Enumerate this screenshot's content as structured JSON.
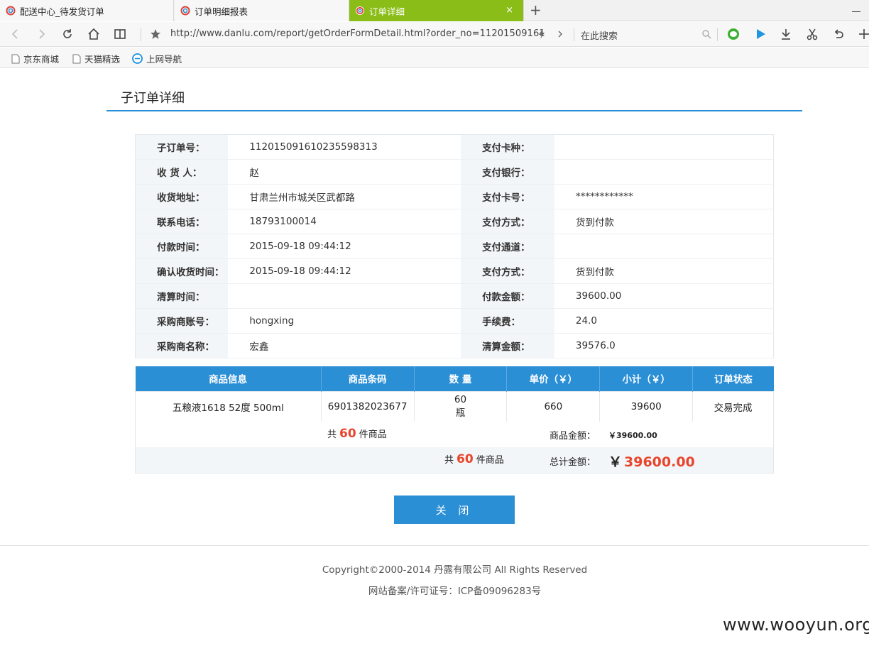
{
  "browser": {
    "tabs": [
      {
        "label": "配送中心_待发货订单"
      },
      {
        "label": "订单明细报表"
      },
      {
        "label": "订单详细"
      }
    ],
    "new_tab": "+",
    "tab_close": "×",
    "url": "http://www.danlu.com/report/getOrderFormDetail.html?order_no=11201509161",
    "search_placeholder": "在此搜索",
    "bookmarks": [
      {
        "label": "京东商城"
      },
      {
        "label": "天猫精选"
      },
      {
        "label": "上网导航"
      }
    ]
  },
  "page": {
    "title": "子订单详细",
    "info_rows": [
      {
        "l1": "子订单号：",
        "v1": "11201509161023559831​3",
        "l2": "支付卡种：",
        "v2": ""
      },
      {
        "l1": "收 货 人：",
        "v1": "赵",
        "l2": "支付银行：",
        "v2": ""
      },
      {
        "l1": "收货地址：",
        "v1": "甘肃兰州市城关区武都路",
        "l2": "支付卡号：",
        "v2": "************"
      },
      {
        "l1": "联系电话：",
        "v1": "18793100014",
        "l2": "支付方式：",
        "v2": "货到付款"
      },
      {
        "l1": "付款时间：",
        "v1": "2015-09-18 09:44:12",
        "l2": "支付通道：",
        "v2": ""
      },
      {
        "l1": "确认收货时间：",
        "v1": "2015-09-18 09:44:12",
        "l2": "支付方式：",
        "v2": "货到付款"
      },
      {
        "l1": "清算时间：",
        "v1": "",
        "l2": "付款金额：",
        "v2": "39600.00"
      },
      {
        "l1": "采购商账号：",
        "v1": "hongxing",
        "l2": "手续费：",
        "v2": "24.0"
      },
      {
        "l1": "采购商名称：",
        "v1": "宏鑫",
        "l2": "清算金额：",
        "v2": "39576.0"
      }
    ],
    "goods_headers": [
      "商品信息",
      "商品条码",
      "数 量",
      "单价（￥）",
      "小计（￥）",
      "订单状态"
    ],
    "goods_rows": [
      {
        "name": "五粮液1618 52度 500ml",
        "barcode": "6901382023677",
        "qty": "60",
        "unit": "瓶",
        "price": "660",
        "subtotal": "39600",
        "status": "交易完成"
      }
    ],
    "summary1": {
      "prefix": "共",
      "count": "60",
      "suffix": "件商品",
      "amount_label": "商品金额：",
      "amount": "￥39600.00"
    },
    "summary2": {
      "prefix": "共",
      "count": "60",
      "suffix": "件商品",
      "amount_label": "总计金额：",
      "yen": "￥",
      "amount": "39600.00"
    },
    "close_label": "关 闭"
  },
  "footer": {
    "copyright": "Copyright©2000-2014 丹露有限公司 All Rights Reserved",
    "icp": "网站备案/许可证号：ICP备09096283号"
  },
  "watermark": "www.wooyun.org",
  "colors": {
    "accent": "#2b8fd6",
    "active_tab": "#8bbd18",
    "highlight": "#e8452c"
  }
}
